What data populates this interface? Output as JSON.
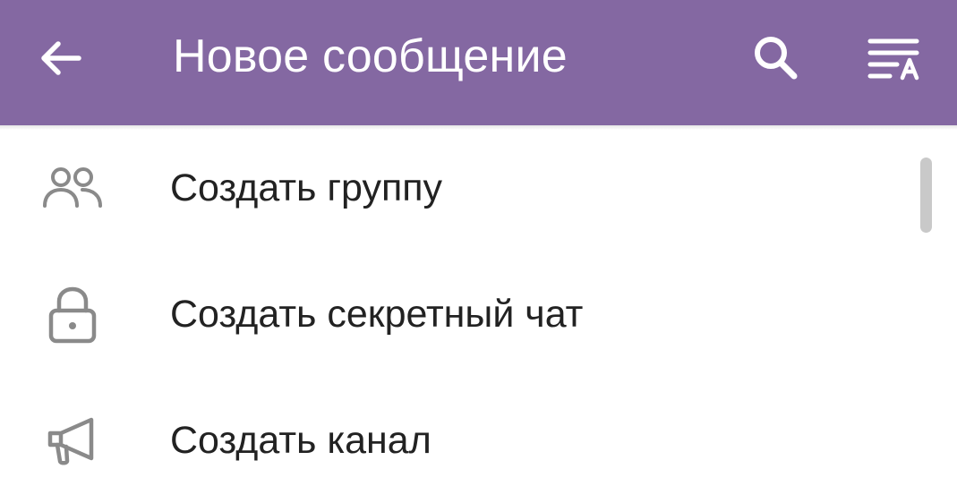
{
  "colors": {
    "app_bar": "#8468a2",
    "app_bar_foreground": "#ffffff",
    "menu_text": "#222222",
    "menu_icon": "#8a8a8a",
    "scrollbar": "#c9c9c9"
  },
  "header": {
    "title": "Новое сообщение",
    "back_icon": "arrow-left-icon",
    "search_icon": "search-icon",
    "sort_icon": "sort-alphabet-icon"
  },
  "menu": {
    "items": [
      {
        "label": "Создать группу",
        "icon": "people-icon"
      },
      {
        "label": "Создать секретный чат",
        "icon": "lock-icon"
      },
      {
        "label": "Создать канал",
        "icon": "megaphone-icon"
      }
    ]
  }
}
